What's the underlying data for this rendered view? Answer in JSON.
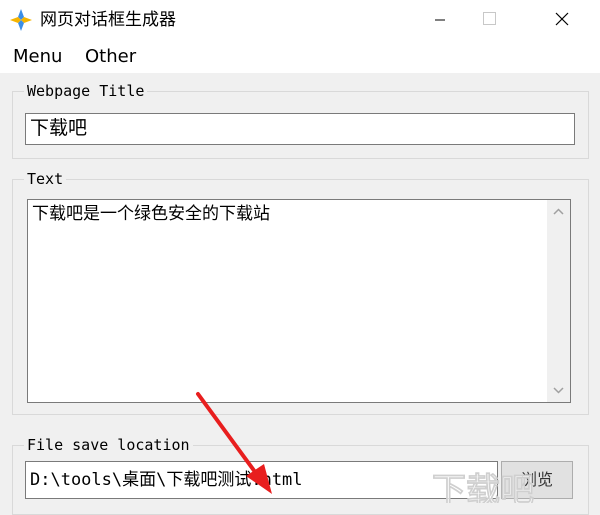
{
  "window": {
    "title": "网页对话框生成器",
    "icons": {
      "app": "app-logo-icon",
      "minimize": "minimize-icon",
      "maximize": "maximize-icon",
      "close": "close-icon"
    }
  },
  "menu": {
    "items": [
      "Menu",
      "Other"
    ]
  },
  "webpage_title": {
    "label": "Webpage Title",
    "value": "下载吧"
  },
  "text_section": {
    "label": "Text",
    "value": "下载吧是一个绿色安全的下载站"
  },
  "file_section": {
    "label": "File save location",
    "path": "D:\\tools\\桌面\\下载吧测试.html",
    "browse_label": "浏览"
  },
  "colors": {
    "annotation_arrow": "#e81e1e",
    "window_bg": "#f0f0f0"
  }
}
